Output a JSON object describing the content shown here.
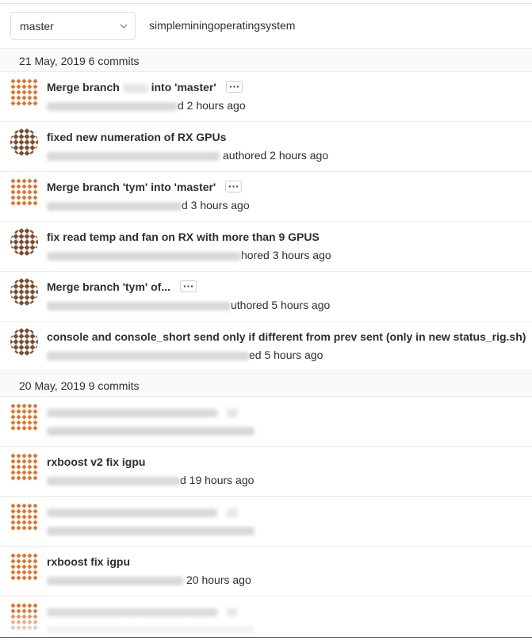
{
  "toolbar": {
    "branch": "master",
    "path": "simpleminingoperatingsystem"
  },
  "days": [
    {
      "header": "21 May, 2019 6 commits"
    },
    {
      "header": "20 May, 2019 9 commits"
    }
  ],
  "commits": [
    {
      "title_start": "Merge branch",
      "title_end": "into 'master'",
      "meta": "d 2 hours ago",
      "avatar": "orange-diamond-identicon"
    },
    {
      "title": "fixed new numeration of RX GPUs",
      "meta": "authored 2 hours ago",
      "avatar": "brown-checker-identicon"
    },
    {
      "title": "Merge branch 'tym' into 'master'",
      "meta": "d 3 hours ago",
      "avatar": "orange-diamond-identicon"
    },
    {
      "title": "fix read temp and fan on RX with more than 9 GPUS",
      "meta": "hored 3 hours ago",
      "avatar": "brown-checker-identicon"
    },
    {
      "title": "Merge branch 'tym' of...",
      "meta": "uthored 5 hours ago",
      "avatar": "brown-checker-identicon"
    },
    {
      "title": "console and console_short send only if different from prev sent (only in new status_rig.sh)",
      "meta": "ed 5 hours ago",
      "avatar": "brown-checker-identicon"
    },
    {
      "title": "",
      "meta": "",
      "avatar": "orange-diamond-identicon"
    },
    {
      "title": "rxboost v2 fix igpu",
      "meta": "d 19 hours ago",
      "avatar": "orange-diamond-identicon"
    },
    {
      "title": "",
      "meta": "",
      "avatar": "orange-diamond-identicon"
    },
    {
      "title": "rxboost fix igpu",
      "meta": "20 hours ago",
      "avatar": "orange-diamond-identicon"
    },
    {
      "title": "",
      "meta": "",
      "avatar": "orange-diamond-identicon"
    }
  ],
  "colors": {
    "orange": "#e0712c",
    "brown": "#7a4e33"
  }
}
